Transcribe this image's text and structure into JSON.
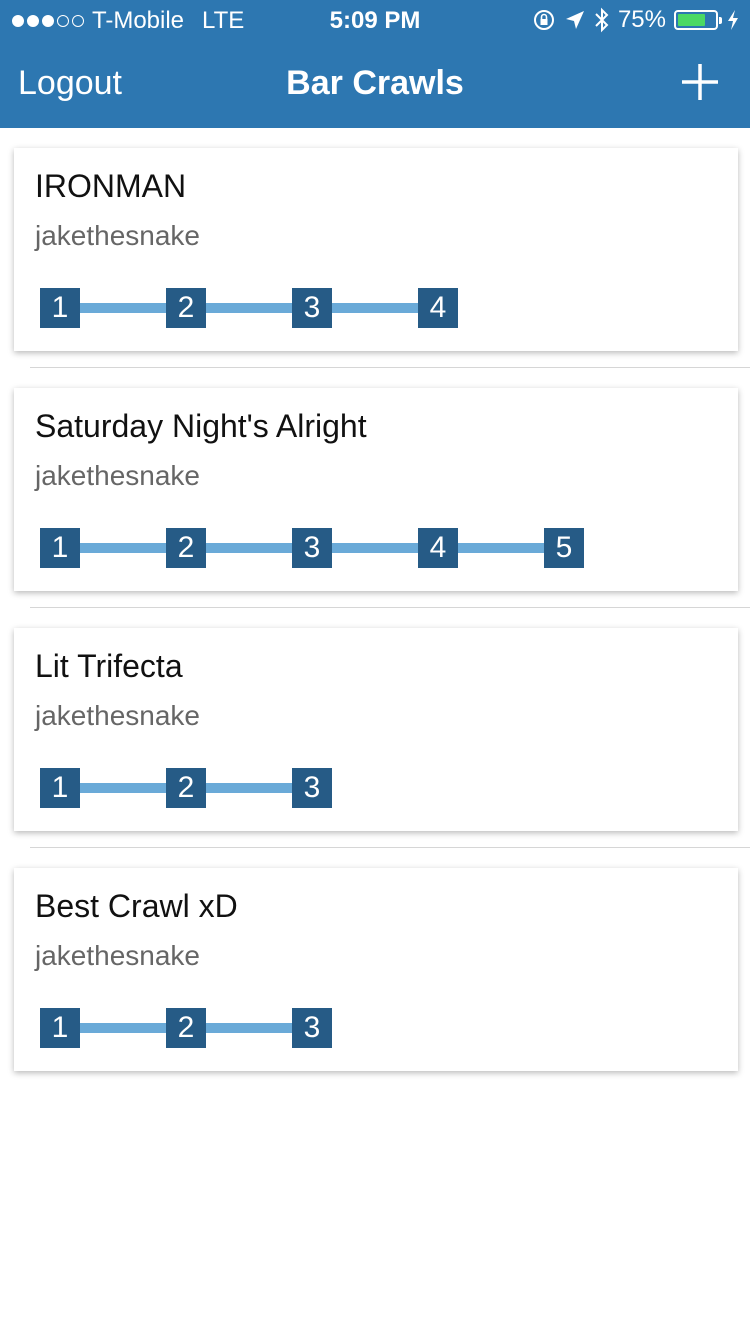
{
  "status_bar": {
    "carrier": "T-Mobile",
    "network": "LTE",
    "signal_filled": 3,
    "signal_total": 5,
    "time": "5:09 PM",
    "battery_text": "75%",
    "battery_level": 0.75
  },
  "nav": {
    "left_button": "Logout",
    "title": "Bar Crawls",
    "add_icon": "plus-icon"
  },
  "crawls": [
    {
      "title": "IRONMAN",
      "author": "jakethesnake",
      "stops": [
        "1",
        "2",
        "3",
        "4"
      ]
    },
    {
      "title": "Saturday Night's Alright",
      "author": "jakethesnake",
      "stops": [
        "1",
        "2",
        "3",
        "4",
        "5"
      ]
    },
    {
      "title": "Lit Trifecta",
      "author": "jakethesnake",
      "stops": [
        "1",
        "2",
        "3"
      ]
    },
    {
      "title": "Best Crawl xD",
      "author": "jakethesnake",
      "stops": [
        "1",
        "2",
        "3"
      ]
    }
  ],
  "colors": {
    "header": "#2d77b1",
    "stop_box": "#265b86",
    "stop_line": "#6aaad8",
    "battery_fill": "#4cd964"
  }
}
